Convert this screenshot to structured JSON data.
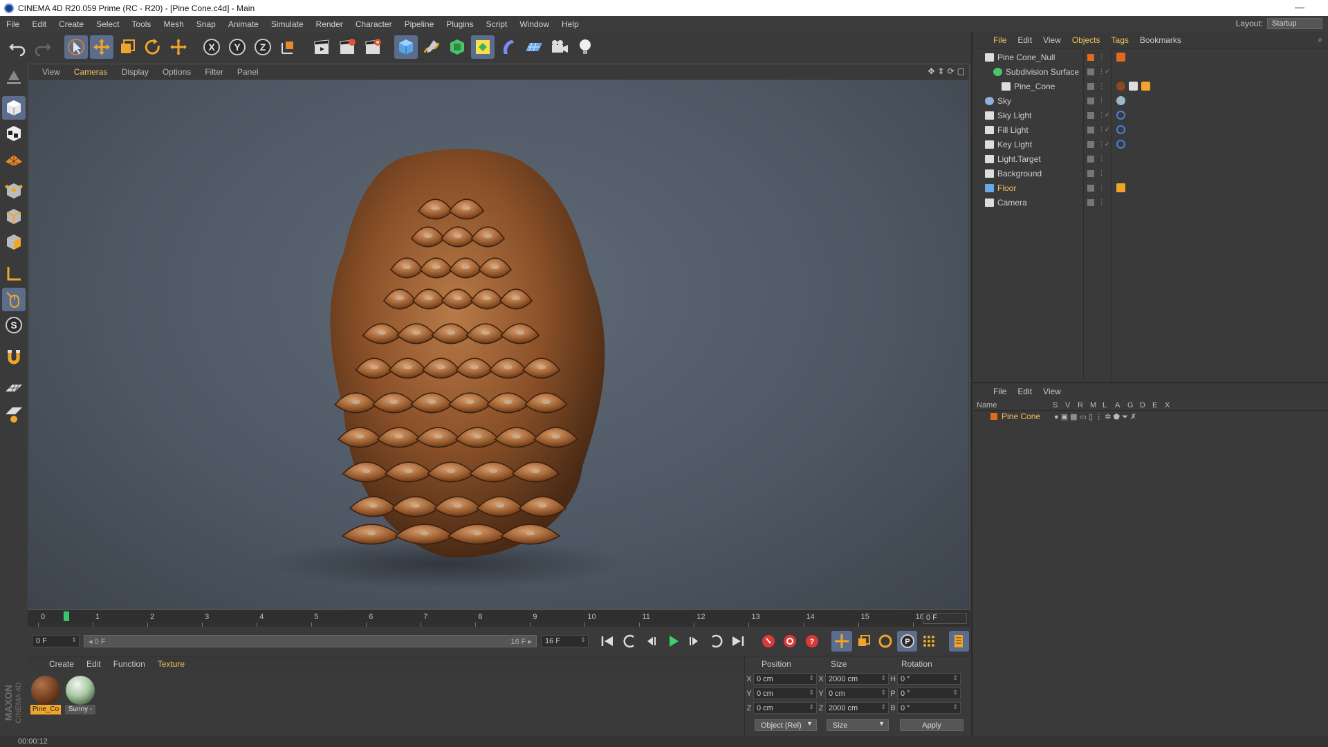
{
  "window": {
    "title": "CINEMA 4D R20.059 Prime (RC - R20) - [Pine Cone.c4d] - Main",
    "minimize": "—"
  },
  "menubar": {
    "items": [
      "File",
      "Edit",
      "Create",
      "Select",
      "Tools",
      "Mesh",
      "Snap",
      "Animate",
      "Simulate",
      "Render",
      "Character",
      "Pipeline",
      "Plugins",
      "Script",
      "Window",
      "Help"
    ],
    "layout_label": "Layout:",
    "layout_value": "Startup"
  },
  "viewport": {
    "menu": [
      "View",
      "Cameras",
      "Display",
      "Options",
      "Filter",
      "Panel"
    ],
    "nav_icons": [
      "move-view-icon",
      "zoom-view-icon",
      "rotate-view-icon",
      "maximize-view-icon"
    ]
  },
  "timeline": {
    "ticks": [
      "0",
      "1",
      "2",
      "3",
      "4",
      "5",
      "6",
      "7",
      "8",
      "9",
      "10",
      "11",
      "12",
      "13",
      "14",
      "15",
      "16"
    ],
    "current_frame": "0 F"
  },
  "animbar": {
    "start_field": "0 F",
    "range_start": "◂ 0 F",
    "range_end": "16 F ▸",
    "end_field": "16 F"
  },
  "material_manager": {
    "menu": [
      "Create",
      "Edit",
      "Function",
      "Texture"
    ],
    "materials": [
      {
        "label": "Pine_Co",
        "selected": true
      },
      {
        "label": "Sunny -",
        "selected": false
      }
    ]
  },
  "coordinates": {
    "headers": {
      "position": "Position",
      "size": "Size",
      "rotation": "Rotation"
    },
    "rows": [
      {
        "pa": "X",
        "pv": "0 cm",
        "sa": "X",
        "sv": "2000 cm",
        "ra": "H",
        "rv": "0 °"
      },
      {
        "pa": "Y",
        "pv": "0 cm",
        "sa": "Y",
        "sv": "0 cm",
        "ra": "P",
        "rv": "0 °"
      },
      {
        "pa": "Z",
        "pv": "0 cm",
        "sa": "Z",
        "sv": "2000 cm",
        "ra": "B",
        "rv": "0 °"
      }
    ],
    "mode_dropdown": "Object (Rel)",
    "size_dropdown": "Size",
    "apply_button": "Apply"
  },
  "status": {
    "time": "00:00:12"
  },
  "brand": {
    "line1": "MAXON",
    "line2": "CINEMA 4D"
  },
  "object_manager": {
    "menu": [
      "File",
      "Edit",
      "View",
      "Objects",
      "Tags",
      "Bookmarks"
    ],
    "objects": [
      {
        "name": "Pine Cone_Null",
        "depth": 0,
        "highlight": false,
        "tags": [
          "layer-color-tag"
        ]
      },
      {
        "name": "Subdivision Surface",
        "depth": 1,
        "highlight": false,
        "tags": []
      },
      {
        "name": "Pine_Cone",
        "depth": 2,
        "highlight": false,
        "tags": [
          "material-tag",
          "phong-tag",
          "weight-tag"
        ]
      },
      {
        "name": "Sky",
        "depth": 0,
        "highlight": false,
        "tags": [
          "sky-material-tag"
        ]
      },
      {
        "name": "Sky Light",
        "depth": 0,
        "highlight": false,
        "tags": [
          "target-tag"
        ]
      },
      {
        "name": "Fill Light",
        "depth": 0,
        "highlight": false,
        "tags": [
          "target-tag"
        ]
      },
      {
        "name": "Key Light",
        "depth": 0,
        "highlight": false,
        "tags": [
          "target-tag"
        ]
      },
      {
        "name": "Light.Target",
        "depth": 0,
        "highlight": false,
        "tags": []
      },
      {
        "name": "Background",
        "depth": 0,
        "highlight": false,
        "tags": []
      },
      {
        "name": "Floor",
        "depth": 0,
        "highlight": true,
        "tags": [
          "compositing-tag"
        ]
      },
      {
        "name": "Camera",
        "depth": 0,
        "highlight": false,
        "tags": []
      }
    ]
  },
  "layer_manager": {
    "menu": [
      "File",
      "Edit",
      "View"
    ],
    "columns": [
      "Name",
      "S",
      "V",
      "R",
      "M",
      "L",
      "A",
      "G",
      "D",
      "E",
      "X"
    ],
    "layers": [
      {
        "name": "Pine Cone"
      }
    ]
  },
  "colors": {
    "accent_orange": "#f0c25a",
    "active_blue": "#5a6d8c",
    "layer_orange": "#e06a1e"
  }
}
